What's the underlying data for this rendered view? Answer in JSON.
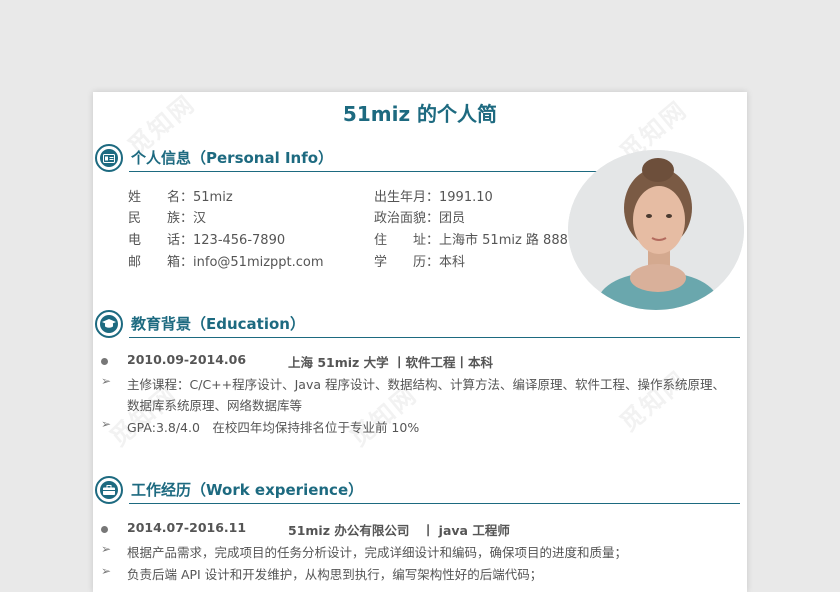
{
  "title": "51miz 的个人简",
  "watermark_text": "觅知网",
  "personal": {
    "heading": "个人信息（Personal Info）",
    "fields": [
      {
        "k": "姓　　名：",
        "v": "51miz"
      },
      {
        "k": "民　　族：",
        "v": "汉"
      },
      {
        "k": "电　　话：",
        "v": "123-456-7890"
      },
      {
        "k": "邮　　箱：",
        "v": "info@51mizppt.com"
      },
      {
        "k": "出生年月：",
        "v": "1991.10"
      },
      {
        "k": "政治面貌：",
        "v": "团员"
      },
      {
        "k": "住　　址：",
        "v": "上海市 51miz 路 888 号"
      },
      {
        "k": "学　　历：",
        "v": "本科"
      }
    ]
  },
  "education": {
    "heading": "教育背景（Education）",
    "period": "2010.09-2014.06",
    "school": "上海 51miz 大学 丨软件工程丨本科",
    "courses_1": "主修课程：C/C++程序设计、Java 程序设计、数据结构、计算方法、编译原理、软件工程、操作系统原理、",
    "courses_2": "数据库系统原理、网络数据库等",
    "gpa": "GPA:3.8/4.0　在校四年均保持排名位于专业前 10%"
  },
  "work": {
    "heading": "工作经历（Work experience）",
    "period": "2014.07-2016.11",
    "company": "51miz 办公有限公司　丨 java 工程师",
    "duty_1": "根据产品需求，完成项目的任务分析设计，完成详细设计和编码，确保项目的进度和质量；",
    "duty_2": "负责后端 API 设计和开发维护，从构思到执行，编写架构性好的后端代码；"
  },
  "colors": {
    "accent": "#1d6a80",
    "text": "#555555"
  }
}
